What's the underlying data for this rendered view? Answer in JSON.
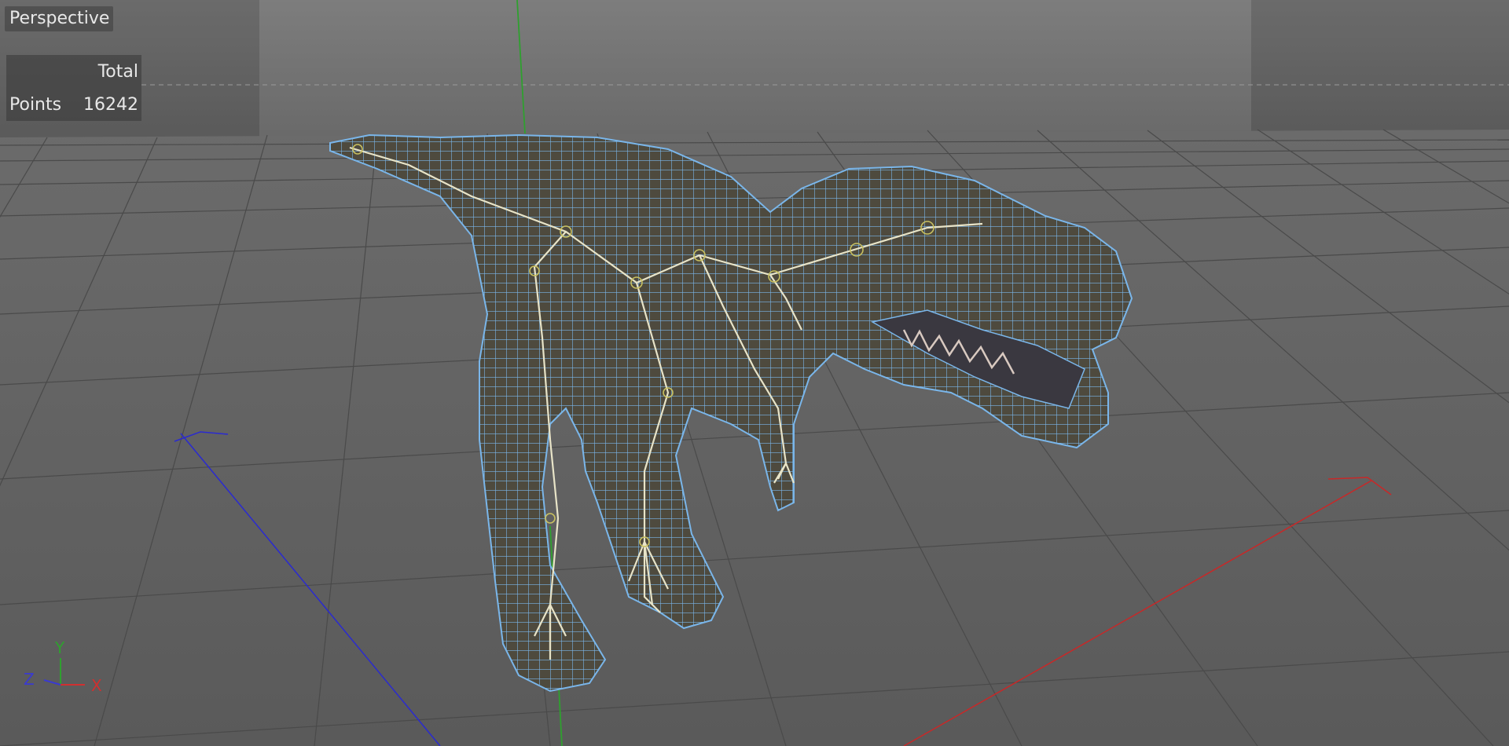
{
  "viewport": {
    "view_name": "Perspective",
    "stats": {
      "header": "Total",
      "rows": [
        {
          "label": "Points",
          "value": "16242"
        }
      ]
    },
    "axis_gizmo": {
      "y_label": "Y",
      "z_label": "Z",
      "x_label": "X",
      "colors": {
        "x": "#d03030",
        "y": "#2fa02f",
        "z": "#3a3ad0"
      }
    },
    "colors": {
      "background_top": "#7d7d7d",
      "background_bottom": "#555555",
      "grid": "#4a4a4a",
      "wireframe": "#7ab6ea",
      "model_fill": "#554f40",
      "skeleton": "#e8e4c8"
    }
  }
}
